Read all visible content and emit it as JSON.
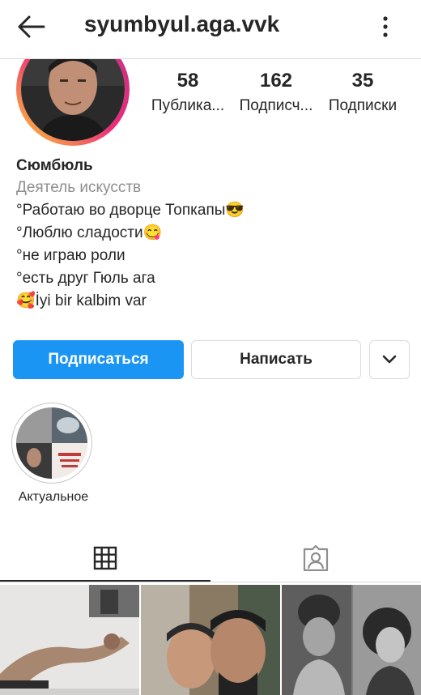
{
  "header": {
    "username": "syumbyul.aga.vvk",
    "back_icon": "arrow-left-icon",
    "menu_icon": "kebab-menu-icon"
  },
  "stats": [
    {
      "value": "58",
      "label": "Публика..."
    },
    {
      "value": "162",
      "label": "Подписч..."
    },
    {
      "value": "35",
      "label": "Подписки"
    }
  ],
  "bio": {
    "name": "Сюмбюль",
    "category": "Деятель искусств",
    "lines": [
      "°Работаю во дворце Топкапы😎",
      "°Люблю сладости😋",
      "°не играю роли",
      "°есть друг Гюль ага",
      "🥰İyi bir kalbim var"
    ]
  },
  "buttons": {
    "follow": "Подписаться",
    "message": "Написать",
    "more_icon": "chevron-down-icon"
  },
  "highlights": [
    {
      "label": "Актуальное"
    }
  ],
  "tabs": [
    {
      "icon": "grid-icon",
      "active": true
    },
    {
      "icon": "tagged-person-icon",
      "active": false
    }
  ],
  "colors": {
    "primary": "#1a95f4",
    "text": "#262626",
    "secondary": "#8e8e8e",
    "border": "#dbdbdb"
  }
}
